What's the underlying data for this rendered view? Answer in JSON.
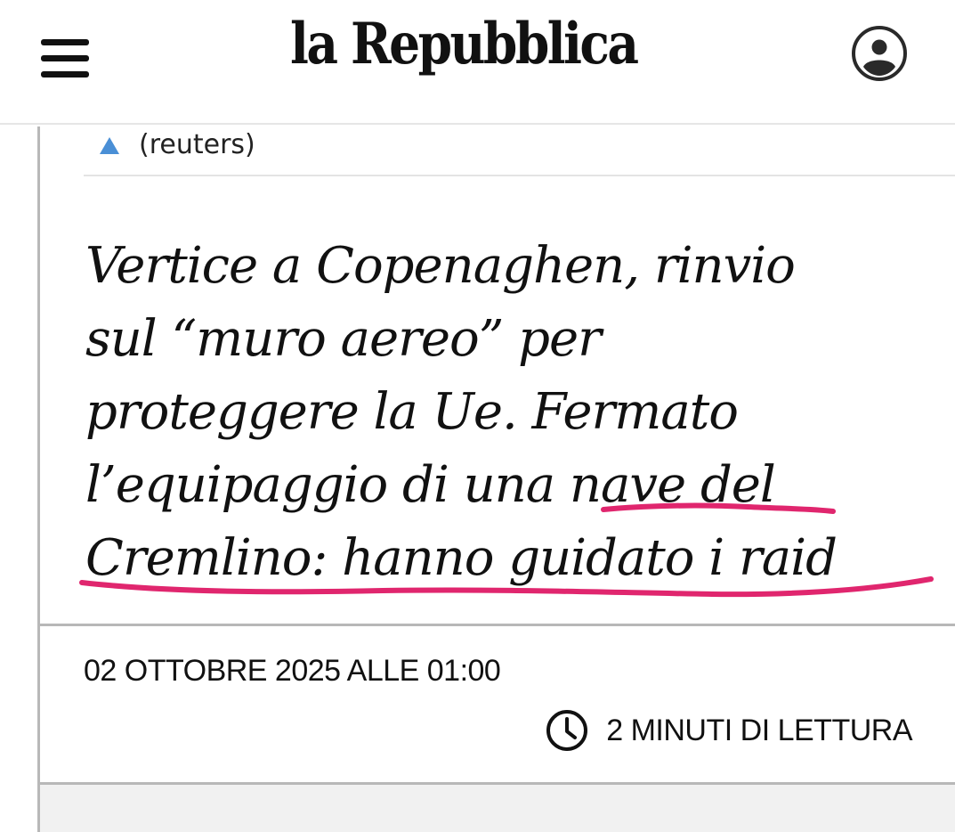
{
  "header": {
    "logo_text": "la Repubblica",
    "menu_icon": "hamburger-menu-icon",
    "account_icon": "user-account-icon"
  },
  "photo_caption": {
    "icon": "triangle-up-icon",
    "text": "(reuters)"
  },
  "article": {
    "headline_lines": [
      "Vertice a Copenaghen, rinvio",
      "sul “muro aereo” per",
      "proteggere la Ue. Fermato",
      "l’equipaggio di una nave del",
      "Cremlino: hanno guidato i raid"
    ],
    "date": "02 OTTOBRE 2025 ALLE 01:00",
    "reading_time": "2 MINUTI DI LETTURA",
    "reading_time_icon": "clock-icon"
  },
  "colors": {
    "caption_triangle": "#4a8fd6",
    "annotation_underline": "#e0266e",
    "text": "#111111",
    "rule": "#b8b8b8"
  }
}
